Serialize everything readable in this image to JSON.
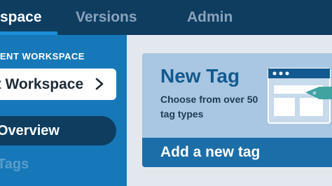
{
  "nav": {
    "tabs": [
      {
        "label": "space"
      },
      {
        "label": "Versions"
      },
      {
        "label": "Admin"
      }
    ]
  },
  "sidebar": {
    "section_label": "RENT WORKSPACE",
    "workspace_value": "ult Workspace",
    "items": [
      {
        "label": "Overview"
      },
      {
        "label": "Tags"
      }
    ]
  },
  "card": {
    "title": "New Tag",
    "description": "Choose from over 50 tag types",
    "action_label": "Add a new tag"
  },
  "colors": {
    "topnav": "#0e3d60",
    "sidebar": "#1678b8",
    "card": "#a9c7e2",
    "card_action": "#1c6ea8",
    "accent": "#1a8fd6"
  },
  "icons": [
    "chevron-right-icon",
    "tag-illustration-icon"
  ]
}
